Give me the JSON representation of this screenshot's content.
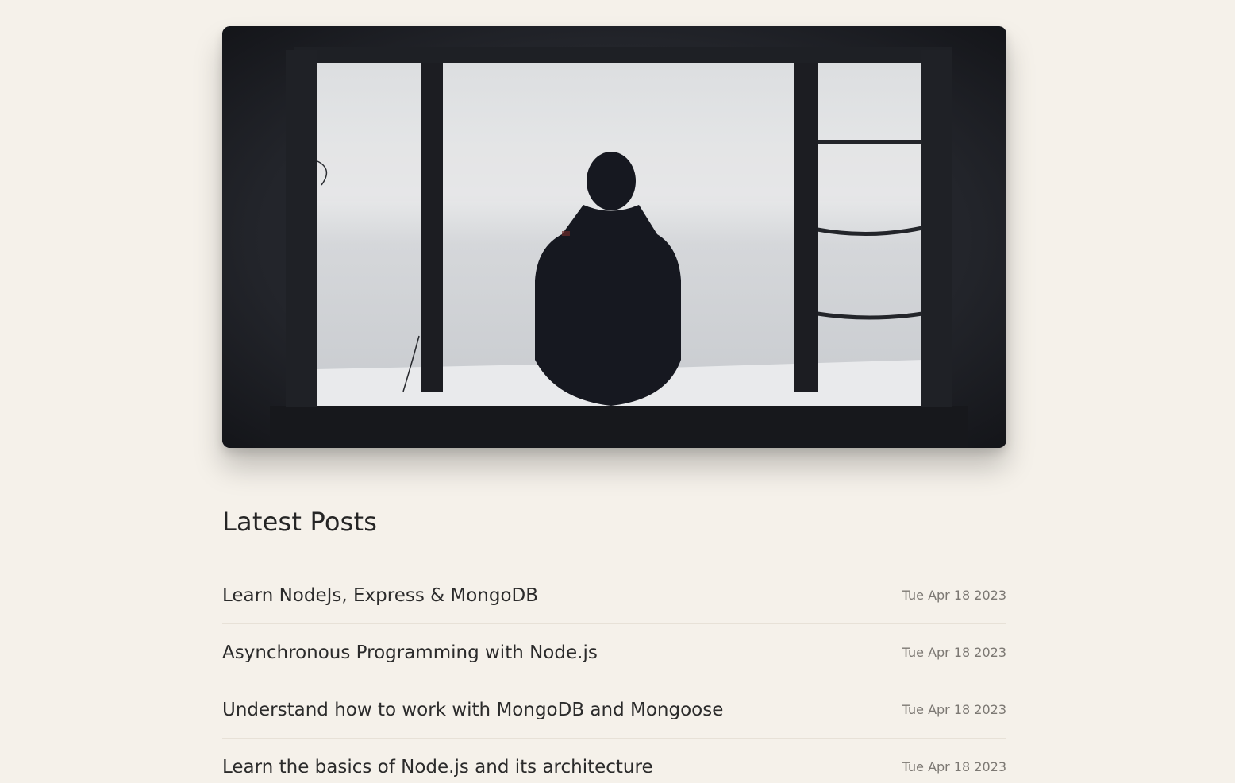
{
  "hero": {
    "image_alt": "Silhouette of a person sitting at a window looking out over a snowy sea"
  },
  "section": {
    "title": "Latest Posts"
  },
  "posts": [
    {
      "title": "Learn NodeJs, Express & MongoDB",
      "date": "Tue Apr 18 2023"
    },
    {
      "title": "Asynchronous Programming with Node.js",
      "date": "Tue Apr 18 2023"
    },
    {
      "title": "Understand how to work with MongoDB and Mongoose",
      "date": "Tue Apr 18 2023"
    },
    {
      "title": "Learn the basics of Node.js and its architecture",
      "date": "Tue Apr 18 2023"
    }
  ],
  "colors": {
    "background": "#f5f1ea",
    "text": "#2b2b2b",
    "muted": "#7c7873"
  }
}
